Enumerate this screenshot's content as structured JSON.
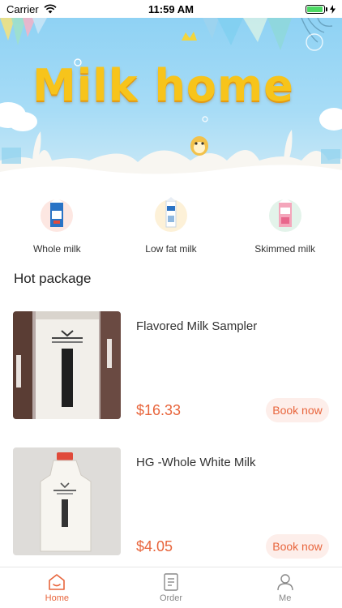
{
  "status_bar": {
    "carrier": "Carrier",
    "time": "11:59 AM",
    "wifi_icon": "wifi-icon",
    "battery_level": 0.95
  },
  "banner": {
    "title": "Milk home"
  },
  "categories": [
    {
      "label": "Whole milk",
      "icon": "whole-milk-carton-icon"
    },
    {
      "label": "Low fat milk",
      "icon": "low-fat-milk-carton-icon"
    },
    {
      "label": "Skimmed milk",
      "icon": "skimmed-milk-carton-icon"
    }
  ],
  "hot_package": {
    "title": "Hot package",
    "items": [
      {
        "name": "Flavored Milk Sampler",
        "price": "$16.33",
        "action": "Book now"
      },
      {
        "name": "HG -Whole White Milk",
        "price": "$4.05",
        "action": "Book now"
      }
    ]
  },
  "tab_bar": {
    "active_color": "#e8653c",
    "inactive_color": "#888888",
    "tabs": [
      {
        "label": "Home",
        "icon": "home-icon",
        "active": true
      },
      {
        "label": "Order",
        "icon": "order-icon",
        "active": false
      },
      {
        "label": "Me",
        "icon": "person-icon",
        "active": false
      }
    ]
  },
  "colors": {
    "accent": "#e8653c",
    "button_bg": "#fdeeea",
    "banner_sky": "#a7dcf6",
    "banner_title": "#f7c41b"
  }
}
